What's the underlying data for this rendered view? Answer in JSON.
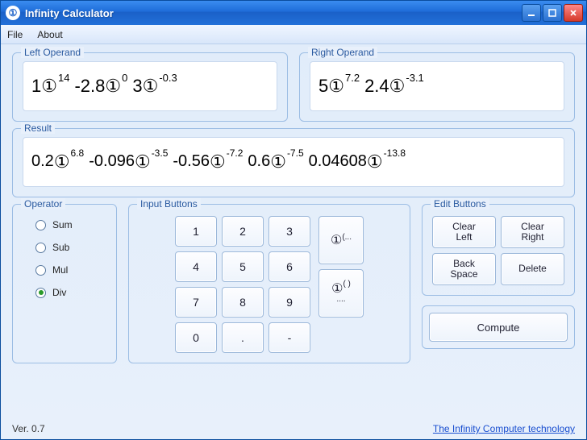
{
  "window": {
    "title": "Infinity Calculator",
    "app_icon_glyph": "①"
  },
  "menubar": {
    "file": "File",
    "about": "About"
  },
  "panels": {
    "left_legend": "Left Operand",
    "right_legend": "Right Operand",
    "result_legend": "Result",
    "operator_legend": "Operator",
    "input_legend": "Input Buttons",
    "edit_legend": "Edit Buttons"
  },
  "left_operand": [
    {
      "coef": "1",
      "exp": "14"
    },
    {
      "coef": "-2.8",
      "exp": "0"
    },
    {
      "coef": "3",
      "exp": "-0.3"
    }
  ],
  "right_operand": [
    {
      "coef": "5",
      "exp": "7.2"
    },
    {
      "coef": "2.4",
      "exp": "-3.1"
    }
  ],
  "result": [
    {
      "coef": "0.2",
      "exp": "6.8"
    },
    {
      "coef": "-0.096",
      "exp": "-3.5"
    },
    {
      "coef": "-0.56",
      "exp": "-7.2"
    },
    {
      "coef": "0.6",
      "exp": "-7.5"
    },
    {
      "coef": "0.04608",
      "exp": "-13.8"
    }
  ],
  "operator": {
    "options": [
      "Sum",
      "Sub",
      "Mul",
      "Div"
    ],
    "selected": "Div"
  },
  "keypad": {
    "keys": [
      "1",
      "2",
      "3",
      "4",
      "5",
      "6",
      "7",
      "8",
      "9",
      "0",
      ".",
      "-"
    ],
    "special_upper": "①(...",
    "special_lower_base": "①",
    "special_lower_sup": "( )",
    "special_lower_sub": "...."
  },
  "edit_buttons": {
    "clear_left": "Clear\nLeft",
    "clear_right": "Clear\nRight",
    "backspace": "Back\nSpace",
    "delete": "Delete"
  },
  "compute_label": "Compute",
  "footer": {
    "version": "Ver. 0.7",
    "link": "The Infinity Computer technology"
  },
  "glyphs": {
    "circled_one": "①"
  }
}
